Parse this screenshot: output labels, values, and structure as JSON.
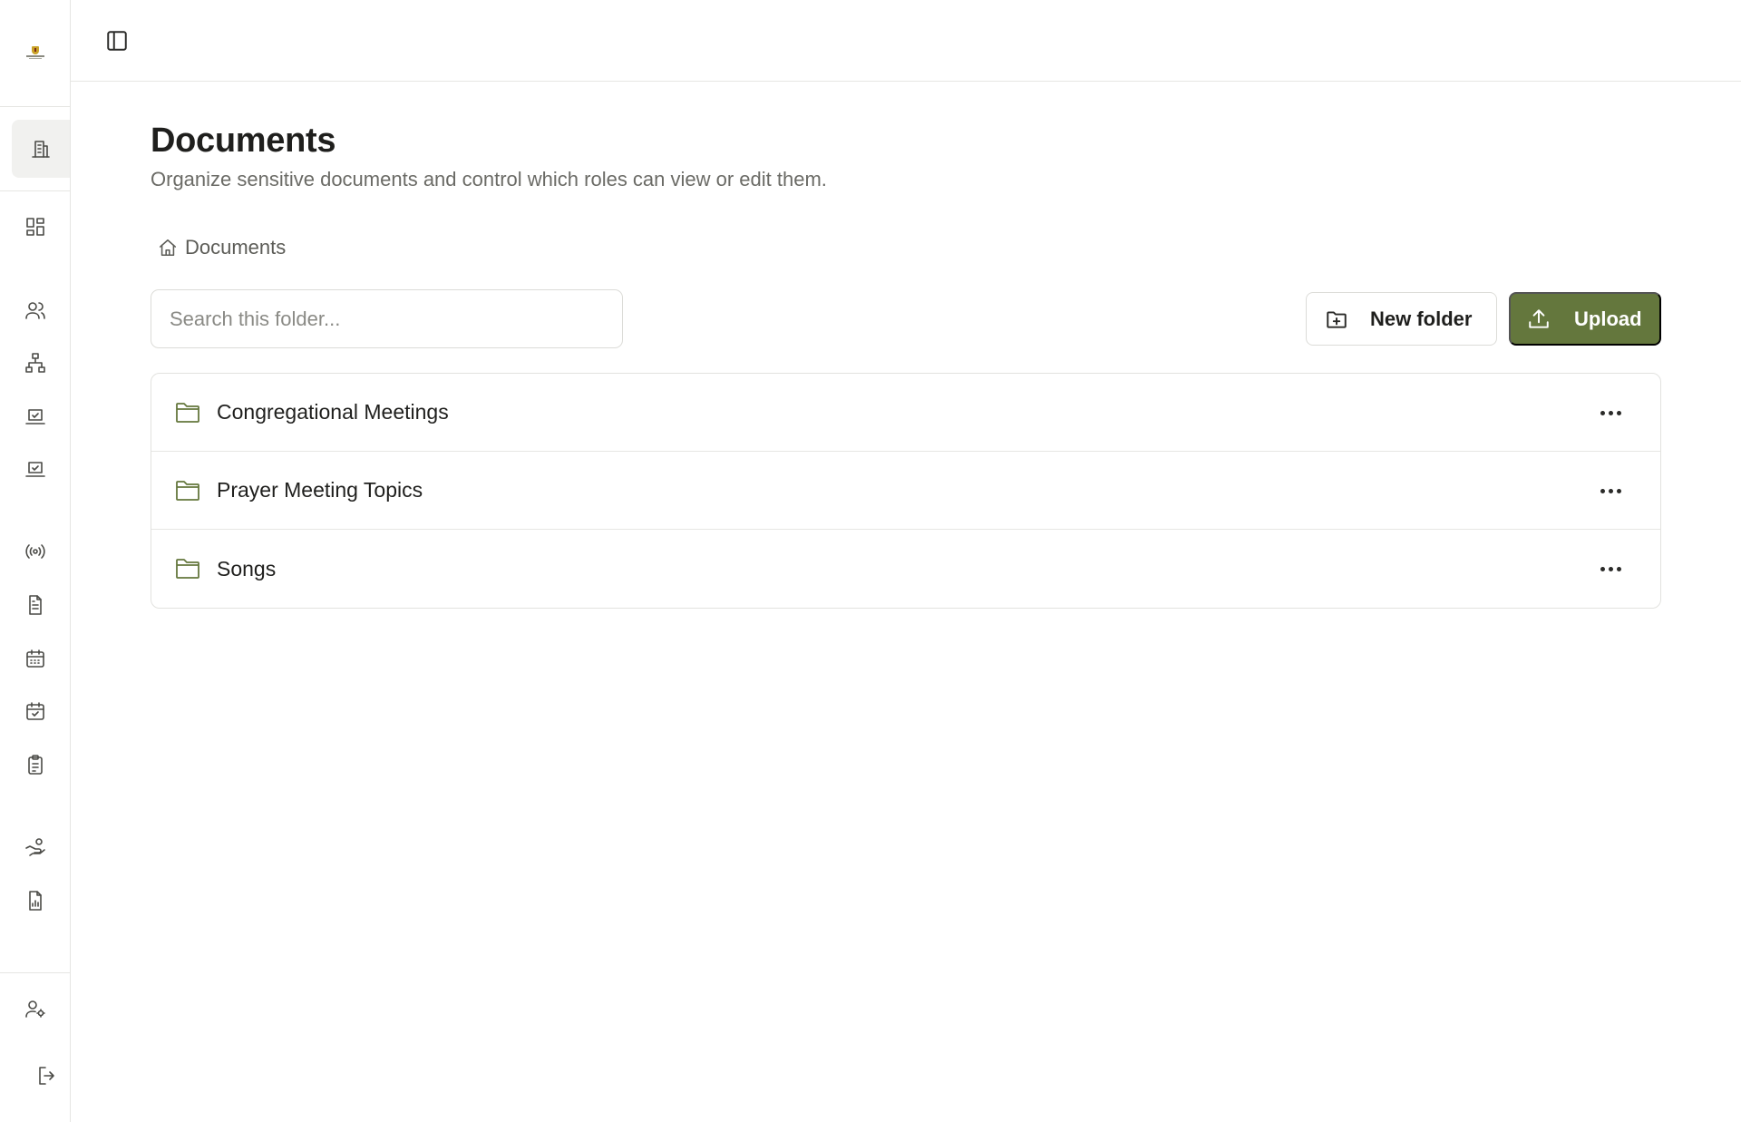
{
  "topbar": {
    "toggle_icon": "sidebar-toggle-icon"
  },
  "sidebar": {
    "logo": "organization-logo",
    "items": [
      {
        "icon": "building-icon",
        "active": true
      },
      {
        "icon": "dashboard-icon"
      },
      {
        "icon": "users-icon"
      },
      {
        "icon": "hierarchy-icon"
      },
      {
        "icon": "laptop-check-icon"
      },
      {
        "icon": "laptop-check-icon"
      },
      {
        "icon": "broadcast-icon"
      },
      {
        "icon": "document-icon"
      },
      {
        "icon": "calendar-icon"
      },
      {
        "icon": "calendar-check-icon"
      },
      {
        "icon": "clipboard-icon"
      },
      {
        "icon": "hand-coins-icon"
      },
      {
        "icon": "file-chart-icon"
      },
      {
        "icon": "user-settings-icon"
      },
      {
        "icon": "logout-icon"
      }
    ]
  },
  "page": {
    "title": "Documents",
    "subtitle": "Organize sensitive documents and control which roles can view or edit them."
  },
  "breadcrumb": {
    "icon": "home-icon",
    "label": "Documents"
  },
  "search": {
    "placeholder": "Search this folder...",
    "value": ""
  },
  "actions": {
    "new_folder_label": "New folder",
    "upload_label": "Upload"
  },
  "folders": [
    {
      "name": "Congregational Meetings"
    },
    {
      "name": "Prayer Meeting Topics"
    },
    {
      "name": "Songs"
    }
  ],
  "colors": {
    "accent": "#64773d",
    "border": "#e2e2df",
    "muted_text": "#6b6b66"
  }
}
